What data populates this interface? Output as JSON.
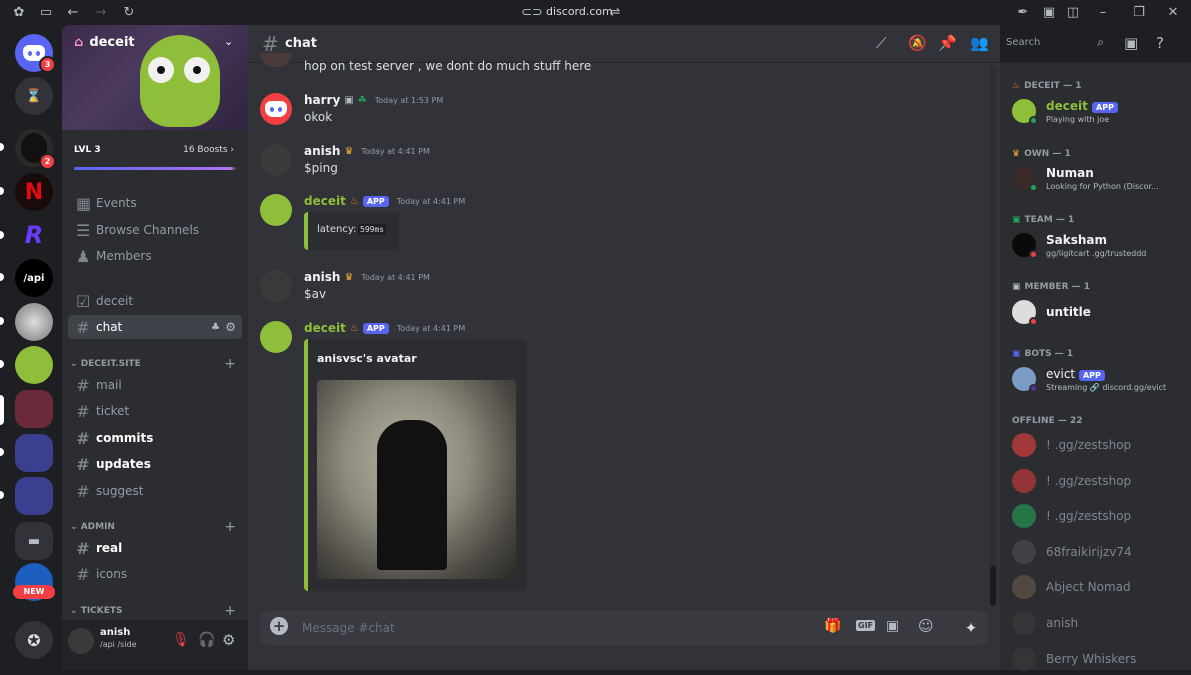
{
  "titlebar": {
    "url": "discord.com"
  },
  "servers": {
    "home_badge": "3",
    "server_badge": "2",
    "api_label": "/api",
    "new_label": "NEW"
  },
  "sidebar": {
    "server_name": "deceit",
    "level": "LVL 3",
    "boosts": "16 Boosts",
    "boost_progress": 0.98,
    "items": [
      {
        "label": "Events"
      },
      {
        "label": "Browse Channels"
      },
      {
        "label": "Members"
      }
    ],
    "channels_top": [
      {
        "label": "deceit"
      },
      {
        "label": "chat"
      }
    ],
    "categories": [
      {
        "label": "DECEIT.SITE",
        "channels": [
          "mail",
          "ticket",
          "commits",
          "updates",
          "suggest"
        ]
      },
      {
        "label": "ADMIN",
        "channels": [
          "real",
          "icons"
        ]
      },
      {
        "label": "TICKETS",
        "channels": []
      }
    ]
  },
  "user": {
    "name": "anish",
    "status": "/api /side"
  },
  "channel": {
    "name": "chat",
    "search_placeholder": "Search",
    "composer_placeholder": "Message #chat"
  },
  "messages": [
    {
      "text": "hop on test server , we dont do much stuff here"
    },
    {
      "author": "harry",
      "time": "Today at 1:53 PM",
      "text": "okok"
    },
    {
      "author": "anish",
      "time": "Today at 4:41 PM",
      "text": "$ping"
    },
    {
      "author": "deceit",
      "tag": "APP",
      "time": "Today at 4:41 PM",
      "embed_label": "latency:",
      "embed_value": "599ms"
    },
    {
      "author": "anish",
      "time": "Today at 4:41 PM",
      "text": "$av"
    },
    {
      "author": "deceit",
      "tag": "APP",
      "time": "Today at 4:41 PM",
      "embed_title": "anisvsc's avatar"
    }
  ],
  "member_list": {
    "groups": [
      {
        "label": "DECEIT — 1",
        "members": [
          {
            "name": "deceit",
            "tag": "APP",
            "sub": "Playing with joe",
            "color": "#8fbf3a"
          }
        ]
      },
      {
        "label": "OWN — 1",
        "members": [
          {
            "name": "Numan",
            "sub": "Looking for Python (Discor..."
          }
        ]
      },
      {
        "label": "TEAM — 1",
        "members": [
          {
            "name": "Saksham",
            "sub": "gg/ligitcart .gg/trusteddd"
          }
        ]
      },
      {
        "label": "MEMBER — 1",
        "members": [
          {
            "name": "untitle"
          }
        ]
      },
      {
        "label": "BOTS — 1",
        "members": [
          {
            "name": "evict",
            "tag": "APP",
            "sub": "Streaming",
            "sub2": "discord.gg/evict"
          }
        ]
      }
    ],
    "offline_label": "OFFLINE — 22",
    "offline": [
      {
        "name": "! .gg/zestshop",
        "color": "#f23f43"
      },
      {
        "name": "! .gg/zestshop",
        "color": "#da373c"
      },
      {
        "name": "! .gg/zestshop",
        "color": "#23a55a"
      },
      {
        "name": "68fraikirijzv74",
        "color": "#4e5058"
      },
      {
        "name": "Abject Nomad",
        "color": "#6b5a4a"
      },
      {
        "name": "anish",
        "color": "#3a3a3a"
      },
      {
        "name": "Berry Whiskers",
        "color": "#3a3a3a"
      }
    ]
  },
  "colors": {
    "accent": "#5865f2",
    "green": "#8fbf3a",
    "red": "#f23f43",
    "online": "#23a55a"
  }
}
